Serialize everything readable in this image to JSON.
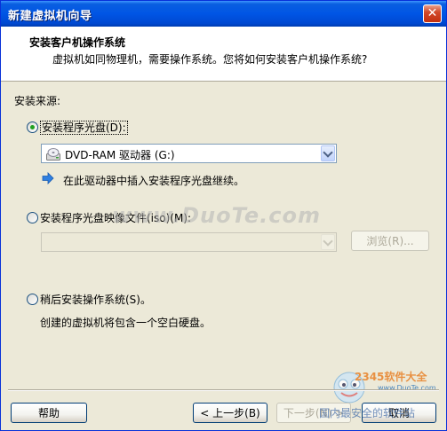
{
  "window": {
    "title": "新建虚拟机向导",
    "close_symbol": "✕"
  },
  "header": {
    "title": "安装客户机操作系统",
    "subtitle": "虚拟机如同物理机，需要操作系统。您将如何安装客户机操作系统?"
  },
  "install_source": {
    "label": "安装来源:",
    "disc_option": {
      "label": "安装程序光盘(D):",
      "selected": true,
      "drive_value": "DVD-RAM 驱动器 (G:)",
      "drive_icon": "dvd-drive-icon",
      "info_icon": "blue-arrow-icon",
      "info_text": "在此驱动器中插入安装程序光盘继续。"
    },
    "iso_option": {
      "label": "安装程序光盘映像文件(iso)(M):",
      "selected": false,
      "path_value": "",
      "browse_label": "浏览(R)..."
    },
    "later_option": {
      "label": "稍后安装操作系统(S)。",
      "selected": false,
      "description": "创建的虚拟机将包含一个空白硬盘。"
    }
  },
  "buttons": {
    "help": "帮助",
    "back": "< 上一步(B)",
    "next": "下一步(N) >",
    "cancel": "取消"
  },
  "overlay": {
    "watermark": "www.DuoTe.com",
    "logo_brand": "2345软件大全",
    "logo_url": "www.DuoTe.com",
    "logo_tagline": "国内最安全的软件站"
  },
  "colors": {
    "titlebar": "#0055e5",
    "selected_radio": "#21a121",
    "info_arrow": "#2f7fe0"
  }
}
